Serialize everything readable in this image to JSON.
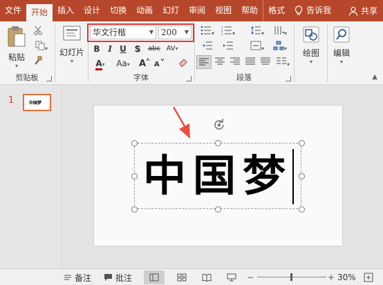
{
  "tabs": [
    "文件",
    "开始",
    "插入",
    "设计",
    "切换",
    "动画",
    "幻灯片放映",
    "审阅",
    "视图",
    "帮助",
    "格式"
  ],
  "tabs_display": [
    "文件",
    "开始",
    "插入",
    "设计",
    "切换",
    "动画",
    "幻灯",
    "审阅",
    "视图",
    "帮助",
    "格式"
  ],
  "active_tab": "开始",
  "tell_me": "告诉我",
  "share": "共享",
  "clipboard": {
    "paste": "粘贴",
    "label": "剪贴板"
  },
  "slides": {
    "new_slide": "幻灯片",
    "label": ""
  },
  "font": {
    "name": "华文行楷",
    "size": "200",
    "label": "字体",
    "bold": "B",
    "italic": "I",
    "underline": "U",
    "shadow": "S",
    "strike": "abc",
    "spacing": "AV",
    "color_letter": "A",
    "case": "Aa",
    "font_color": "#c00000"
  },
  "paragraph": {
    "label": "段落"
  },
  "drawing": {
    "label": "绘图"
  },
  "editing": {
    "label": "编辑"
  },
  "slide_pane": {
    "number": "1",
    "thumb_text": "中国梦"
  },
  "slide": {
    "text": "中国梦"
  },
  "status": {
    "notes": "备注",
    "comments": "批注",
    "zoom": "30%"
  },
  "colors": {
    "brand": "#b7472a",
    "highlight": "#e03a3a",
    "accent": "#d24726"
  }
}
